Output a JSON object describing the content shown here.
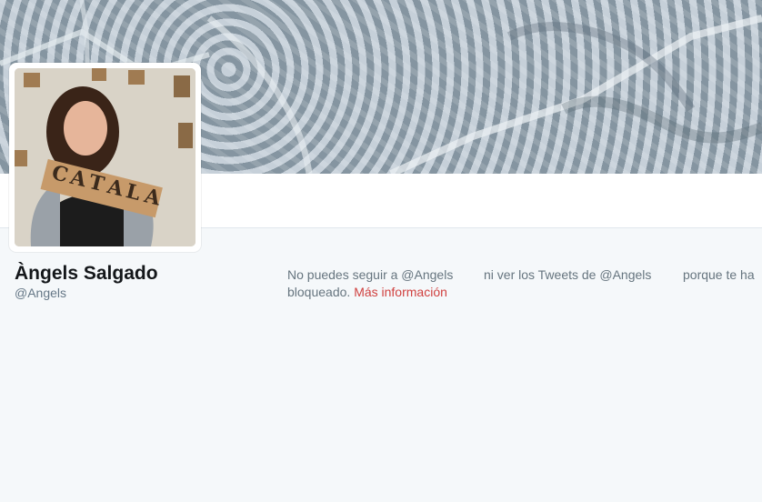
{
  "profile": {
    "name": "Àngels Salgado",
    "handle": "@Angels"
  },
  "avatar": {
    "sign_letters": [
      "C",
      "A",
      "T",
      "A",
      "L",
      "A"
    ]
  },
  "blocked_notice": {
    "part1": "No puedes seguir a @Angels",
    "part2": "ni ver los Tweets de @Angels",
    "part3": "porque te ha",
    "part4": "bloqueado.",
    "link": "Más información"
  },
  "colors": {
    "background": "#f5f8fa",
    "link": "#d0413f",
    "name": "#14171a",
    "muted": "#66757f"
  }
}
